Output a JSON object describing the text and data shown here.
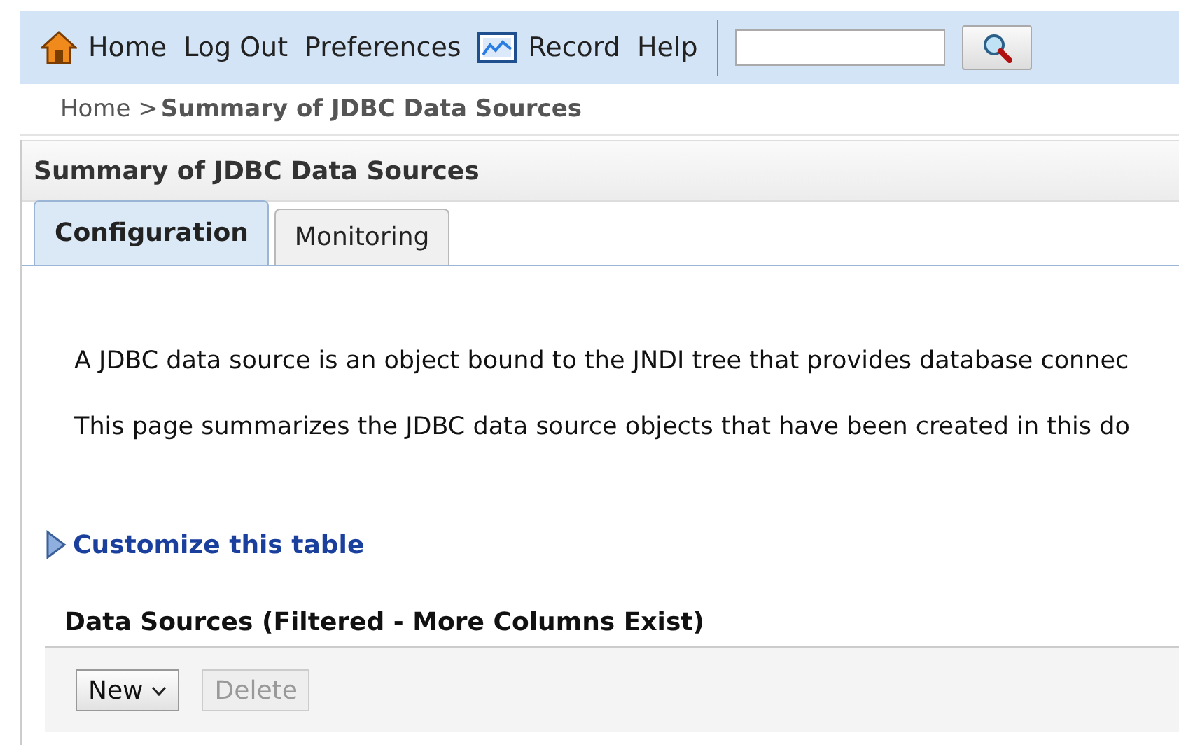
{
  "nav": {
    "items": [
      {
        "label": "Home",
        "kind": "home"
      },
      {
        "label": "Log Out",
        "kind": "link"
      },
      {
        "label": "Preferences",
        "kind": "link"
      },
      {
        "label": "Record",
        "kind": "record"
      },
      {
        "label": "Help",
        "kind": "link"
      }
    ]
  },
  "breadcrumb": {
    "parent": "Home >",
    "current": "Summary of JDBC Data Sources"
  },
  "panel": {
    "title": "Summary of JDBC Data Sources",
    "tabs": [
      {
        "label": "Configuration",
        "selected": true
      },
      {
        "label": "Monitoring",
        "selected": false
      }
    ],
    "paragraphs": [
      "A JDBC data source is an object bound to the JNDI tree that provides database connec",
      "This page summarizes the JDBC data source objects that have been created in this do"
    ],
    "customize_link": "Customize this table",
    "table": {
      "title": "Data Sources (Filtered - More Columns Exist)",
      "buttons": [
        {
          "label": "New",
          "kind": "dropdown",
          "disabled": false
        },
        {
          "label": "Delete",
          "kind": "plain",
          "disabled": true
        }
      ]
    }
  }
}
